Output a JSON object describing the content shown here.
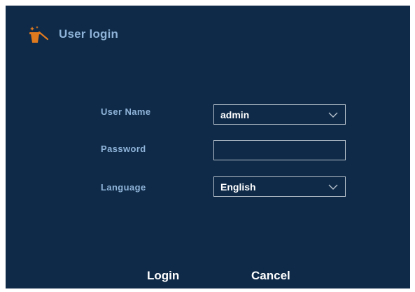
{
  "dialog": {
    "title": "User login",
    "title_icon": "wizard-hat-icon",
    "accent_color": "#e07a1f"
  },
  "form": {
    "username": {
      "label": "User Name",
      "value": "admin",
      "icon": "chevron-down-icon"
    },
    "password": {
      "label": "Password",
      "value": ""
    },
    "language": {
      "label": "Language",
      "value": "English",
      "icon": "chevron-down-icon"
    }
  },
  "buttons": {
    "login": "Login",
    "cancel": "Cancel"
  }
}
